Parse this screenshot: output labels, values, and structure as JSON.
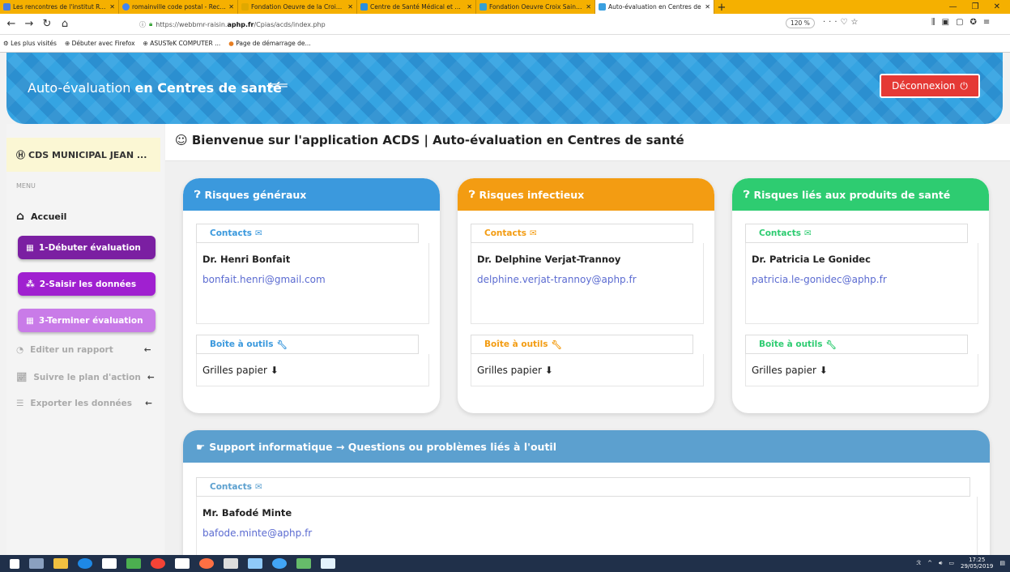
{
  "browser": {
    "tabs": [
      {
        "title": "Les rencontres de l'institut Ren",
        "color": "#4a7de0",
        "active": false
      },
      {
        "title": "romainville code postal - Reche",
        "color": "#4285f4",
        "active": false
      },
      {
        "title": "Fondation Oeuvre de la Croix S",
        "color": "#e0a800",
        "active": false
      },
      {
        "title": "Centre de Santé Médical et Den",
        "color": "#2a8fe0",
        "active": false
      },
      {
        "title": "Fondation Oeuvre Croix Saint S",
        "color": "#34a0d0",
        "active": false
      },
      {
        "title": "Auto-évaluation en Centres de",
        "color": "#3aa0e0",
        "active": true
      }
    ],
    "url_prefix": "https://webbmr-raisin.",
    "url_host": "aphp.fr",
    "url_path": "/Cpias/acds/index.php",
    "zoom": "120 %",
    "bookmarks": [
      "Les plus visités",
      "Débuter avec Firefox",
      "ASUSTeK COMPUTER ...",
      "Page de démarrage de..."
    ]
  },
  "header": {
    "title_light": "Auto-évaluation ",
    "title_bold": "en Centres de santé",
    "logout": "Déconnexion"
  },
  "sidebar": {
    "org": "CDS MUNICIPAL JEAN ...",
    "menu_label": "MENU",
    "home": "Accueil",
    "step1": "1-Débuter évaluation",
    "step2": "2-Saisir les données",
    "step3": "3-Terminer évaluation",
    "report": "Editer un rapport",
    "action_plan": "Suivre le plan d'action",
    "export": "Exporter les données"
  },
  "main": {
    "welcome": "Bienvenue sur l'application ACDS | Auto-évaluation en Centres de santé",
    "cards": [
      {
        "title": "Risques généraux",
        "color": "#3b99dd",
        "contacts_label": "Contacts",
        "name": "Dr. Henri Bonfait",
        "email": "bonfait.henri@gmail.com",
        "tools_label": "Boîte à outils",
        "tools_item": "Grilles papier"
      },
      {
        "title": "Risques infectieux",
        "color": "#f39c12",
        "contacts_label": "Contacts",
        "name": "Dr. Delphine Verjat-Trannoy",
        "email": "delphine.verjat-trannoy@aphp.fr",
        "tools_label": "Boîte à outils",
        "tools_item": "Grilles papier"
      },
      {
        "title": "Risques liés aux produits de santé",
        "color": "#2ecc71",
        "contacts_label": "Contacts",
        "name": "Dr. Patricia Le Gonidec",
        "email": "patricia.le-gonidec@aphp.fr",
        "tools_label": "Boîte à outils",
        "tools_item": "Grilles papier"
      }
    ],
    "support": {
      "title": "Support informatique → Questions ou problèmes liés à l'outil",
      "contacts_label": "Contacts",
      "name": "Mr. Bafodé Minte",
      "email": "bafode.minte@aphp.fr"
    }
  },
  "taskbar": {
    "time": "17:25",
    "date": "29/05/2019"
  }
}
